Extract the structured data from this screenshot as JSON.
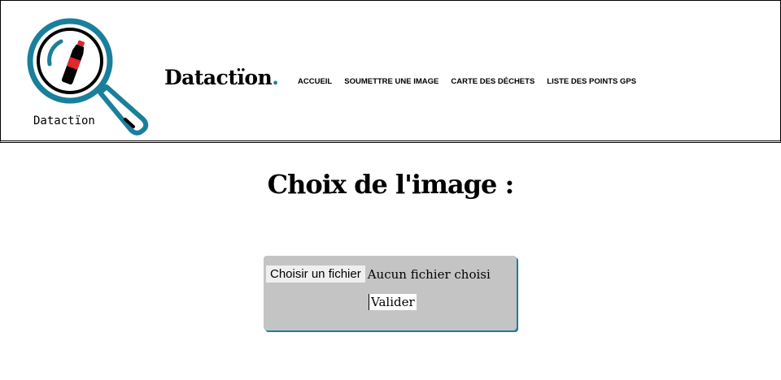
{
  "header": {
    "logo_caption": "Datactïon",
    "brand": "Datactïon",
    "brand_dot": ".",
    "nav": [
      {
        "label": "ACCUEIL"
      },
      {
        "label": "SOUMETTRE UNE IMAGE"
      },
      {
        "label": "CARTE DES DÉCHETS"
      },
      {
        "label": "LISTE DES POINTS GPS"
      }
    ]
  },
  "main": {
    "title": "Choix de l'image :",
    "file_button": "Choisir un fichier",
    "file_status": "Aucun fichier choisi",
    "submit": "Valider"
  },
  "colors": {
    "accent": "#1a7f9b",
    "bottle": "#e0282d",
    "form_bg": "#c4c4c4"
  }
}
